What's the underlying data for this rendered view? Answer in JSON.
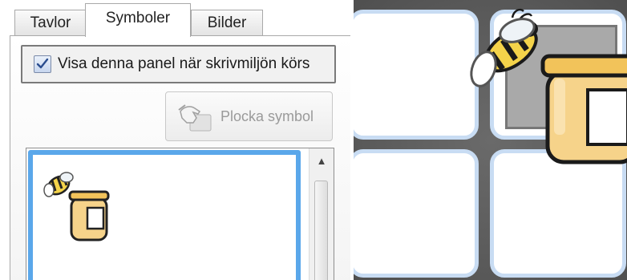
{
  "tabs": [
    {
      "label": "Tavlor",
      "active": false
    },
    {
      "label": "Symboler",
      "active": true
    },
    {
      "label": "Bilder",
      "active": false
    }
  ],
  "panel": {
    "show_panel_checkbox": {
      "label": "Visa denna panel när skrivmiljön körs",
      "checked": true
    },
    "pick_symbol_button": {
      "label": "Plocka symbol",
      "enabled": false,
      "icon": "hand-pointer-icon"
    }
  },
  "symbol_list": {
    "items": [
      {
        "icon": "bee-honey-jar-icon"
      }
    ]
  },
  "grid": {
    "cells": [
      {
        "content": ""
      },
      {
        "content": "bee-honey-jar-icon"
      },
      {
        "content": ""
      },
      {
        "content": ""
      }
    ]
  },
  "colors": {
    "accent_blue": "#5aa7ea",
    "cell_border": "#c8dcf3",
    "background_dark": "#5b5b5b"
  }
}
